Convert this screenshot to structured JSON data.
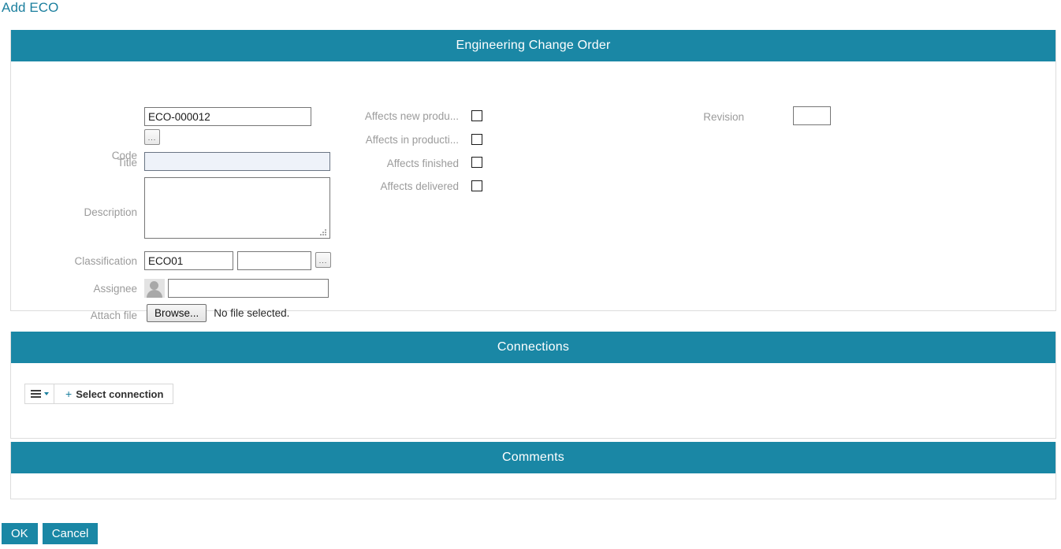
{
  "page": {
    "title": "Add ECO"
  },
  "eco_panel": {
    "header": "Engineering Change Order",
    "fields": {
      "code": {
        "label": "Code",
        "value": "ECO-000012",
        "picker_label": "...",
        "placeholder": ""
      },
      "title": {
        "label": "Title",
        "value": "",
        "placeholder": ""
      },
      "description": {
        "label": "Description",
        "value": "",
        "placeholder": ""
      },
      "classification": {
        "label": "Classification",
        "value": "ECO01",
        "secondary_value": "",
        "picker_label": "..."
      },
      "assignee": {
        "label": "Assignee",
        "value": "",
        "avatar_alt": "user-avatar"
      },
      "attach_file": {
        "label": "Attach file",
        "browse_label": "Browse...",
        "file_status": "No file selected."
      },
      "revision": {
        "label": "Revision",
        "value": ""
      }
    },
    "checkboxes": [
      {
        "label": "Affects new produ...",
        "checked": false
      },
      {
        "label": "Affects in producti...",
        "checked": false
      },
      {
        "label": "Affects finished",
        "checked": false
      },
      {
        "label": "Affects delivered",
        "checked": false
      }
    ]
  },
  "connections_panel": {
    "header": "Connections",
    "toolbar": {
      "menu_icon": "hamburger-icon",
      "caret_icon": "chevron-down-icon",
      "plus_icon": "+",
      "select_label": "Select connection"
    }
  },
  "comments_panel": {
    "header": "Comments"
  },
  "footer": {
    "ok_label": "OK",
    "cancel_label": "Cancel"
  },
  "colors": {
    "accent": "#1a87a5",
    "title_link": "#1b7f9e",
    "label_gray": "#9b9b9b",
    "highlight_field": "#eef2f9"
  }
}
